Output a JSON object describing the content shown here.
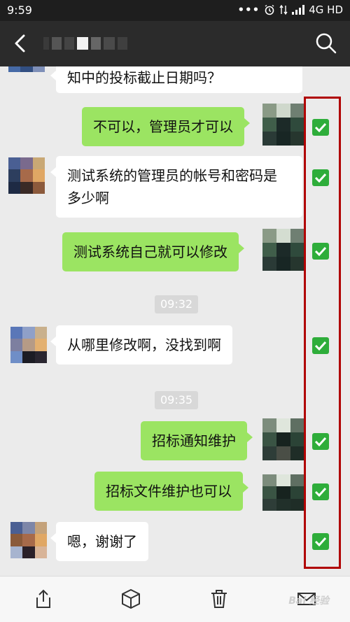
{
  "status": {
    "time": "9:59",
    "dots": "•••",
    "network": "4G HD"
  },
  "header": {
    "back_icon": "back-arrow-icon",
    "search_icon": "search-icon",
    "title_obscured": true
  },
  "chat": {
    "truncated_top": "知中的投标截止日期吗？",
    "m1": "不可以，管理员才可以",
    "m2_line1": "测试系统的管理员的帐号和密码是",
    "m2_line2": "多少啊",
    "m3": "测试系统自己就可以修改",
    "time1": "09:32",
    "m4": "从哪里修改啊，没找到啊",
    "time2": "09:35",
    "m5": "招标通知维护",
    "m6": "招标文件维护也可以",
    "m7": "嗯，谢谢了"
  },
  "toolbar": {
    "share_icon": "share-icon",
    "favorite_icon": "cube-icon",
    "delete_icon": "trash-icon",
    "mail_icon": "mail-icon"
  },
  "watermark": "Bai 经验",
  "colors": {
    "outgoing": "#9be462",
    "incoming": "#ffffff",
    "check": "#2ead3a",
    "highlight": "#b00000"
  }
}
